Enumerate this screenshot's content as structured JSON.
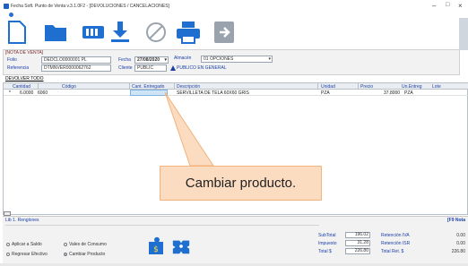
{
  "window": {
    "title": "Fecha Soft. Punto de Venta v.3.1.0F2 - [DEVOLUCIONES / CANCELACIONES]",
    "minimize": "–",
    "maximize": "□",
    "close": "×"
  },
  "toolbar": {
    "buttons": [
      {
        "name": "new-document",
        "icon": "new-document-icon"
      },
      {
        "name": "open-folder",
        "icon": "folder-icon"
      },
      {
        "name": "cash",
        "icon": "cash-icon"
      },
      {
        "name": "save-download",
        "icon": "download-icon"
      },
      {
        "name": "cancel",
        "icon": "cancel-icon"
      },
      {
        "name": "print",
        "icon": "printer-icon"
      },
      {
        "name": "exit",
        "icon": "exit-icon"
      }
    ]
  },
  "nota": {
    "section_label": "[NOTA DE VENTA]",
    "folio_label": "Folio",
    "folio_value": "DEDCLO0000001 PL",
    "referencia_label": "Referencia",
    "referencia_value": "DTMNVER0000062762",
    "fecha_label": "Fecha",
    "fecha_value": "27/08/2020",
    "almacen_label": "Almacén",
    "almacen_value": "01 OPCIONES",
    "cliente_label": "Cliente",
    "cliente_value": "PUBLIC",
    "cliente_name": "PUBLICO EN GENERAL"
  },
  "devolver_todo": "DEVOLVER TODO",
  "grid": {
    "headers": [
      "Cantidad",
      "Código",
      "Cant. Entregado",
      "Descripción",
      "Unidad",
      "Precio",
      "Un.Entreg",
      "Lote"
    ],
    "rows": [
      {
        "marker": "*",
        "cantidad": "6.0000",
        "codigo": "6060",
        "cant_entregado": "",
        "descripcion": "SERVILLETA DE TELA 60X60 GRIS",
        "unidad": "PZA",
        "precio": "37.8000",
        "un_entreg": "PZA",
        "lote": ""
      }
    ]
  },
  "callout": {
    "text": "Cambiar producto.",
    "fill": "#fbdcc0",
    "border": "#f2b27a"
  },
  "footer": {
    "tab_label": "Lib 1. Renglones",
    "nota_label": "[F9 Nota",
    "radios": [
      {
        "label": "Aplicar a Saldo",
        "selected": false
      },
      {
        "label": "Vales de Consumo",
        "selected": false
      },
      {
        "label": "Regresar Efectivo",
        "selected": false
      },
      {
        "label": "Cambiar Producto",
        "selected": true
      }
    ]
  },
  "totals": {
    "subtotal_label": "SubTotal",
    "subtotal_value": "196.02",
    "impuesto_label": "Impuesto",
    "impuesto_value": "31.28",
    "total_label": "Total  $",
    "total_value": "226.80",
    "retencion_iva_label": "Retención IVA",
    "retencion_iva_value": "0.00",
    "retencion_isr_label": "Retención ISR",
    "retencion_isr_value": "0.00",
    "total_ret_label": "Total  Ret.  $",
    "total_ret_value": "226.80"
  }
}
